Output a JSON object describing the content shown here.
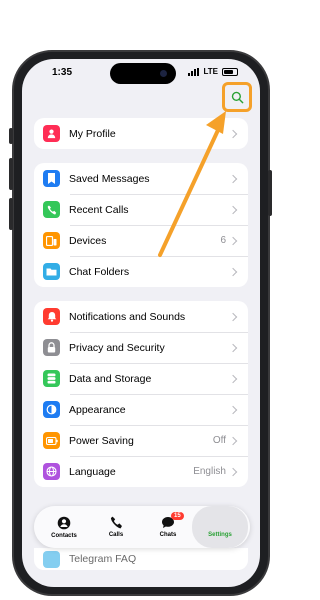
{
  "status": {
    "time": "1:35",
    "network": "LTE"
  },
  "header": {
    "search_icon": "search-icon",
    "highlight_color": "#f5a12a"
  },
  "profile": {
    "label": "My Profile",
    "icon": "person-icon",
    "color": "#ff2d55"
  },
  "group1": [
    {
      "label": "Saved Messages",
      "icon": "bookmark-icon",
      "color": "#1e7cf2",
      "value": ""
    },
    {
      "label": "Recent Calls",
      "icon": "phone-icon",
      "color": "#34c759",
      "value": ""
    },
    {
      "label": "Devices",
      "icon": "devices-icon",
      "color": "#ff9500",
      "value": "6"
    },
    {
      "label": "Chat Folders",
      "icon": "folder-icon",
      "color": "#32ade6",
      "value": ""
    }
  ],
  "group2": [
    {
      "label": "Notifications and Sounds",
      "icon": "bell-icon",
      "color": "#ff3b30",
      "value": ""
    },
    {
      "label": "Privacy and Security",
      "icon": "lock-icon",
      "color": "#8e8e93",
      "value": ""
    },
    {
      "label": "Data and Storage",
      "icon": "database-icon",
      "color": "#34c759",
      "value": ""
    },
    {
      "label": "Appearance",
      "icon": "appearance-icon",
      "color": "#1e7cf2",
      "value": ""
    },
    {
      "label": "Power Saving",
      "icon": "battery-icon",
      "color": "#ff9500",
      "value": "Off"
    },
    {
      "label": "Language",
      "icon": "globe-icon",
      "color": "#af52de",
      "value": "English"
    }
  ],
  "faq": {
    "label": "Telegram FAQ"
  },
  "tabbar": {
    "contacts": "Contacts",
    "calls": "Calls",
    "chats": "Chats",
    "chats_badge": "15",
    "settings": "Settings"
  }
}
